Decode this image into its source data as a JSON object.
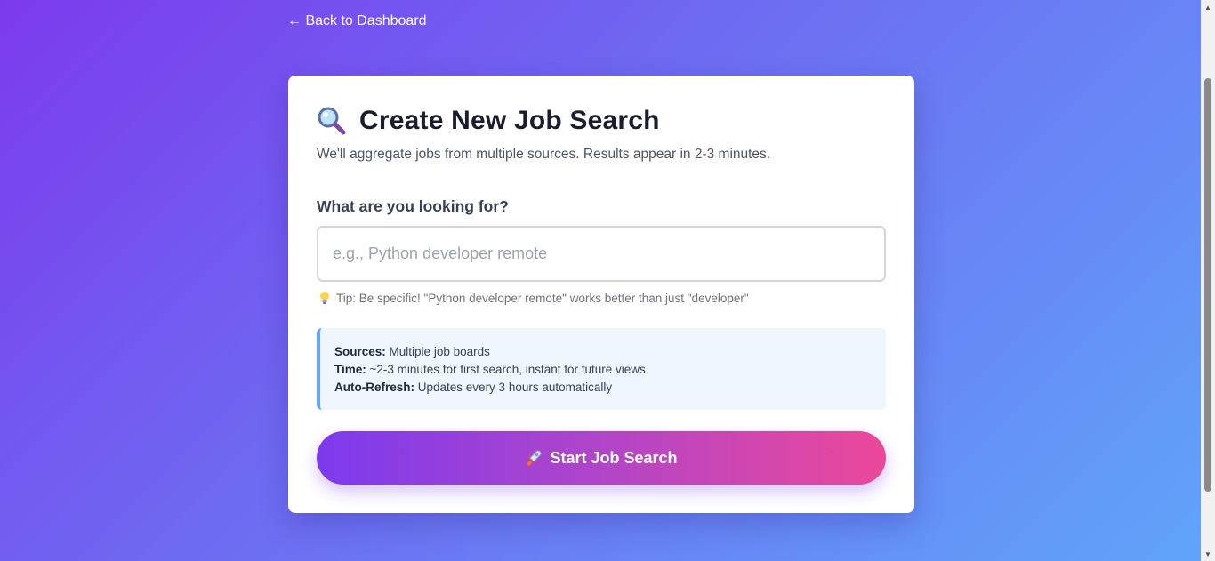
{
  "nav": {
    "back_label": "← Back to Dashboard"
  },
  "card": {
    "title": "Create New Job Search",
    "title_icon": "magnifier-icon",
    "subtitle": "We'll aggregate jobs from multiple sources. Results appear in 2-3 minutes.",
    "field_label": "What are you looking for?",
    "search": {
      "placeholder": "e.g., Python developer remote",
      "value": ""
    },
    "tip": {
      "icon": "lightbulb-icon",
      "text": "Tip: Be specific! \"Python developer remote\" works better than just \"developer\""
    },
    "info": {
      "sources_label": "Sources:",
      "sources_value": "Multiple job boards",
      "time_label": "Time:",
      "time_value": "~2-3 minutes for first search, instant for future views",
      "refresh_label": "Auto-Refresh:",
      "refresh_value": "Updates every 3 hours automatically"
    },
    "start_button": {
      "icon": "rocket-icon",
      "label": "Start Job Search"
    }
  },
  "colors": {
    "background_start": "#7c3aed",
    "background_end": "#60a5fa",
    "button_start": "#7c3aed",
    "button_end": "#ec4899",
    "info_accent": "#60a5fa"
  }
}
